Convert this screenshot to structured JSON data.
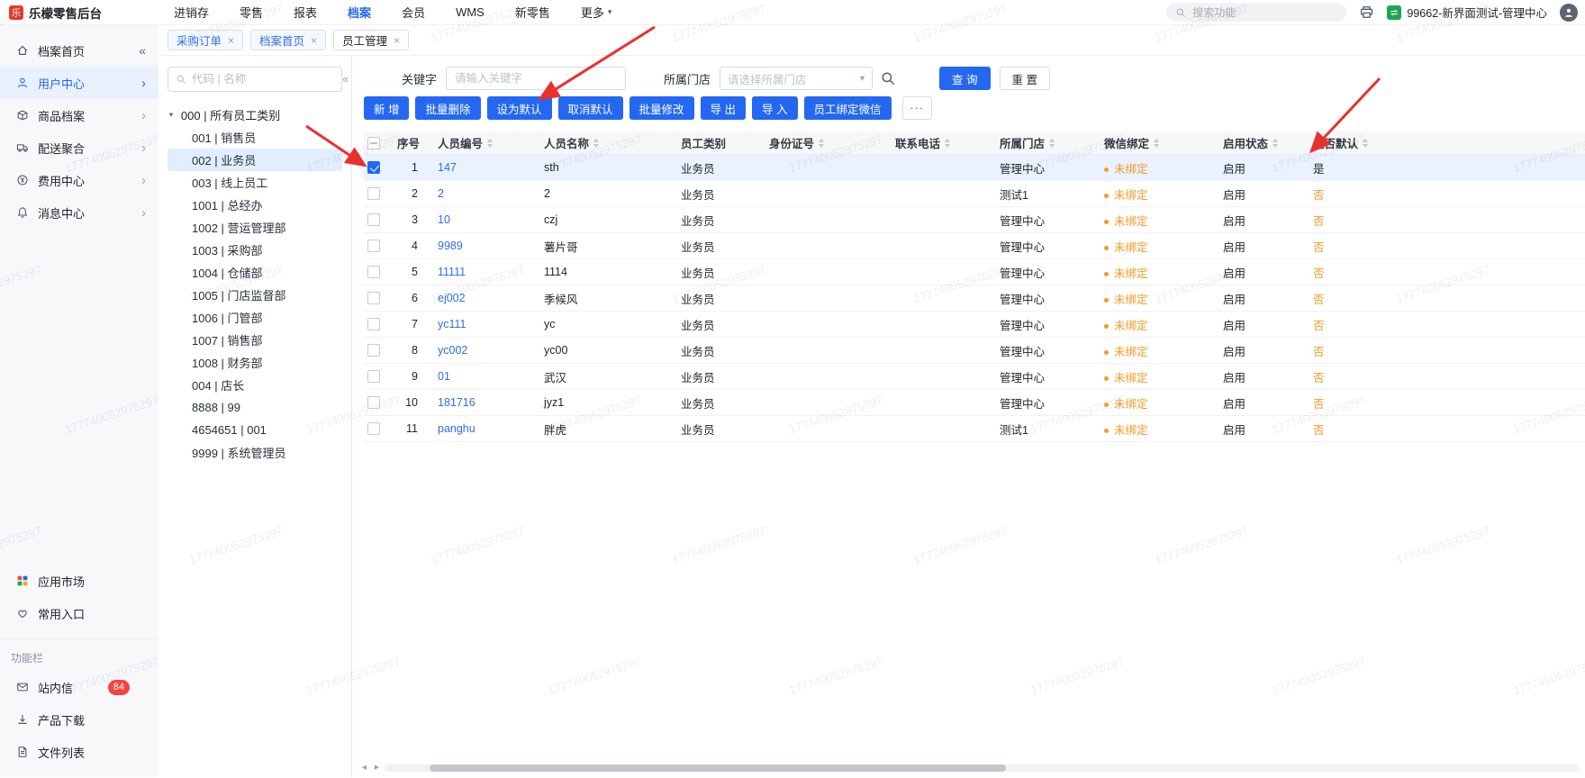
{
  "watermark": {
    "text": "177740052975297"
  },
  "colors": {
    "primary_blue": "#2468f2",
    "link_blue": "#2f6fe4",
    "warning_orange": "#f59a23",
    "badge_red": "#f5463d",
    "arrow_red": "#e8312f",
    "account_green": "#1fa654"
  },
  "icons": {
    "caret_down": "▼",
    "select_caret": "▾",
    "chevron_right": "›",
    "collapse_left": "«",
    "close": "×",
    "more": "···",
    "scroll_left": "◀",
    "scroll_right": "▶"
  },
  "topnav": {
    "brand": "乐檬零售后台",
    "brand_logo_letter": "乐",
    "menu": [
      {
        "label": "进销存"
      },
      {
        "label": "零售"
      },
      {
        "label": "报表"
      },
      {
        "label": "档案",
        "active": true
      },
      {
        "label": "会员"
      },
      {
        "label": "WMS"
      },
      {
        "label": "新零售"
      },
      {
        "label": "更多",
        "dropdown": true
      }
    ],
    "search_placeholder": "搜索功能",
    "account": "99662-新界面测试-管理中心"
  },
  "sidebar": {
    "primary": [
      {
        "label": "档案首页",
        "icon": "home",
        "collapse": true
      },
      {
        "label": "用户中心",
        "icon": "user",
        "active": true,
        "chevron": true
      },
      {
        "label": "商品档案",
        "icon": "box",
        "chevron": true
      },
      {
        "label": "配送聚合",
        "icon": "truck",
        "chevron": true
      },
      {
        "label": "费用中心",
        "icon": "money",
        "chevron": true
      },
      {
        "label": "消息中心",
        "icon": "bell",
        "chevron": true
      }
    ],
    "secondary": [
      {
        "label": "应用市场",
        "icon": "apps"
      },
      {
        "label": "常用入口",
        "icon": "heart"
      }
    ],
    "section_label": "功能栏",
    "tools": [
      {
        "label": "站内信",
        "icon": "mail",
        "badge": "84"
      },
      {
        "label": "产品下载",
        "icon": "download"
      },
      {
        "label": "文件列表",
        "icon": "file"
      }
    ]
  },
  "tabs": [
    {
      "label": "采购订单"
    },
    {
      "label": "档案首页"
    },
    {
      "label": "员工管理",
      "active": true
    }
  ],
  "tree": {
    "search_placeholder": "代码 | 名称",
    "root": {
      "label": "000 | 所有员工类别",
      "expanded": true
    },
    "children": [
      {
        "label": "001 | 销售员"
      },
      {
        "label": "002 | 业务员",
        "selected": true
      },
      {
        "label": "003 | 线上员工"
      },
      {
        "label": "1001 | 总经办"
      },
      {
        "label": "1002 | 营运管理部"
      },
      {
        "label": "1003 | 采购部"
      },
      {
        "label": "1004 | 仓储部"
      },
      {
        "label": "1005 | 门店监督部"
      },
      {
        "label": "1006 | 门管部"
      },
      {
        "label": "1007 | 销售部"
      },
      {
        "label": "1008 | 财务部"
      },
      {
        "label": "004 | 店长"
      },
      {
        "label": "8888 | 99"
      },
      {
        "label": "4654651 | 001"
      },
      {
        "label": "9999 | 系统管理员"
      }
    ]
  },
  "filters": {
    "keyword_label": "关键字",
    "keyword_placeholder": "请输入关键字",
    "store_label": "所属门店",
    "store_placeholder": "请选择所属门店",
    "query_button": "查 询",
    "reset_button": "重 置"
  },
  "toolbar": {
    "buttons": [
      "新 增",
      "批量删除",
      "设为默认",
      "取消默认",
      "批量修改",
      "导 出",
      "导 入",
      "员工绑定微信"
    ],
    "more_button": "···"
  },
  "table": {
    "columns": [
      {
        "label": "序号",
        "key": "seq"
      },
      {
        "label": "人员编号",
        "key": "code",
        "sortable": true
      },
      {
        "label": "人员名称",
        "key": "name",
        "sortable": true
      },
      {
        "label": "员工类别",
        "key": "type"
      },
      {
        "label": "身份证号",
        "key": "id_no",
        "sortable": true
      },
      {
        "label": "联系电话",
        "key": "phone",
        "sortable": true
      },
      {
        "label": "所属门店",
        "key": "store",
        "sortable": true
      },
      {
        "label": "微信绑定",
        "key": "wechat",
        "sortable": true
      },
      {
        "label": "启用状态",
        "key": "status",
        "sortable": true
      },
      {
        "label": "是否默认",
        "key": "is_default",
        "sortable": true
      }
    ],
    "rows": [
      {
        "checked": true,
        "seq": "1",
        "code": "147",
        "name": "sth",
        "type": "业务员",
        "id_no": "",
        "phone": "",
        "store": "管理中心",
        "wechat": "未绑定",
        "status": "启用",
        "is_default": "是"
      },
      {
        "seq": "2",
        "code": "2",
        "name": "2",
        "type": "业务员",
        "id_no": "",
        "phone": "",
        "store": "测试1",
        "wechat": "未绑定",
        "status": "启用",
        "is_default": "否"
      },
      {
        "seq": "3",
        "code": "10",
        "name": "czj",
        "type": "业务员",
        "id_no": "",
        "phone": "",
        "store": "管理中心",
        "wechat": "未绑定",
        "status": "启用",
        "is_default": "否"
      },
      {
        "seq": "4",
        "code": "9989",
        "name": "薯片哥",
        "type": "业务员",
        "id_no": "",
        "phone": "",
        "store": "管理中心",
        "wechat": "未绑定",
        "status": "启用",
        "is_default": "否"
      },
      {
        "seq": "5",
        "code": "11111",
        "name": "1114",
        "type": "业务员",
        "id_no": "",
        "phone": "",
        "store": "管理中心",
        "wechat": "未绑定",
        "status": "启用",
        "is_default": "否"
      },
      {
        "seq": "6",
        "code": "ej002",
        "name": "季候风",
        "type": "业务员",
        "id_no": "",
        "phone": "",
        "store": "管理中心",
        "wechat": "未绑定",
        "status": "启用",
        "is_default": "否"
      },
      {
        "seq": "7",
        "code": "yc111",
        "name": "yc",
        "type": "业务员",
        "id_no": "",
        "phone": "",
        "store": "管理中心",
        "wechat": "未绑定",
        "status": "启用",
        "is_default": "否"
      },
      {
        "seq": "8",
        "code": "yc002",
        "name": "yc00",
        "type": "业务员",
        "id_no": "",
        "phone": "",
        "store": "管理中心",
        "wechat": "未绑定",
        "status": "启用",
        "is_default": "否"
      },
      {
        "seq": "9",
        "code": "01",
        "name": "武汉",
        "type": "业务员",
        "id_no": "",
        "phone": "",
        "store": "管理中心",
        "wechat": "未绑定",
        "status": "启用",
        "is_default": "否"
      },
      {
        "seq": "10",
        "code": "181716",
        "name": "jyz1",
        "type": "业务员",
        "id_no": "",
        "phone": "",
        "store": "管理中心",
        "wechat": "未绑定",
        "status": "启用",
        "is_default": "否"
      },
      {
        "seq": "11",
        "code": "panghu",
        "name": "胖虎",
        "type": "业务员",
        "id_no": "",
        "phone": "",
        "store": "测试1",
        "wechat": "未绑定",
        "status": "启用",
        "is_default": "否"
      }
    ]
  }
}
